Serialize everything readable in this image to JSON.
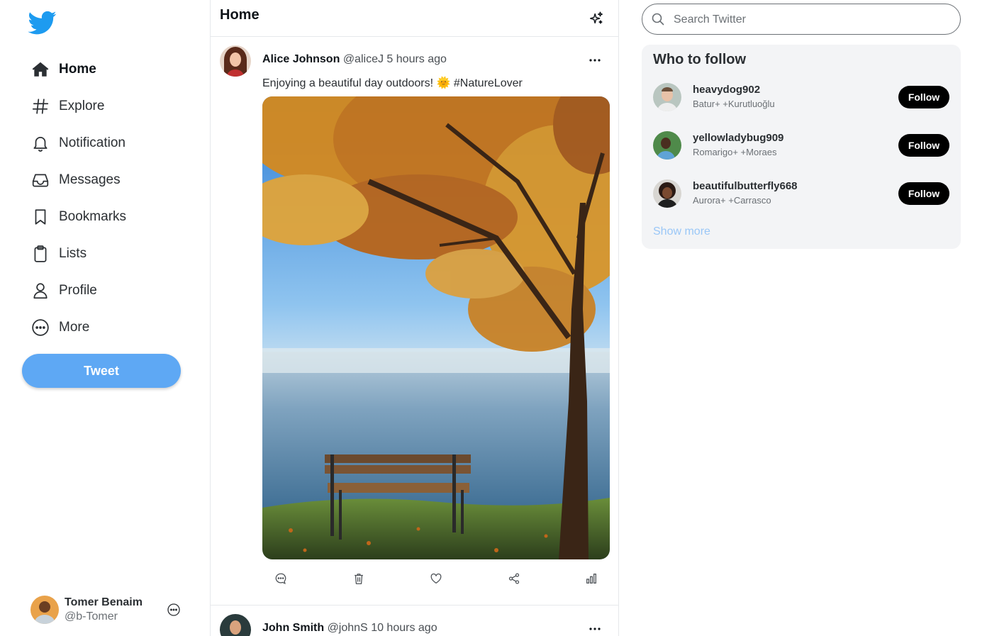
{
  "colors": {
    "brand": "#1d9bf0",
    "tweet_button": "#5ea8f4",
    "show_more": "#9ac7f7",
    "follow_button": "#000000"
  },
  "sidebar": {
    "logo_icon": "twitter-bird-icon",
    "items": [
      {
        "label": "Home",
        "icon": "home-icon",
        "active": true
      },
      {
        "label": "Explore",
        "icon": "hash-icon"
      },
      {
        "label": "Notification",
        "icon": "bell-icon"
      },
      {
        "label": "Messages",
        "icon": "inbox-icon"
      },
      {
        "label": "Bookmarks",
        "icon": "bookmark-icon"
      },
      {
        "label": "Lists",
        "icon": "clipboard-icon"
      },
      {
        "label": "Profile",
        "icon": "user-icon"
      },
      {
        "label": "More",
        "icon": "more-circle-icon"
      }
    ],
    "tweet_button": "Tweet",
    "account": {
      "name": "Tomer Benaim",
      "handle": "@b-Tomer"
    }
  },
  "main": {
    "title": "Home",
    "posts": [
      {
        "name": "Alice Johnson",
        "handle": "@aliceJ",
        "time": "5 hours ago",
        "text": "Enjoying a beautiful day outdoors! 🌞 #NatureLover"
      },
      {
        "name": "John Smith",
        "handle": "@johnS",
        "time": "10 hours ago"
      }
    ]
  },
  "search": {
    "placeholder": "Search Twitter"
  },
  "who_to_follow": {
    "title": "Who to follow",
    "users": [
      {
        "username": "heavydog902",
        "subtitle": "Batur+ +Kurutluoğlu",
        "button": "Follow"
      },
      {
        "username": "yellowladybug909",
        "subtitle": "Romarigo+ +Moraes",
        "button": "Follow"
      },
      {
        "username": "beautifulbutterfly668",
        "subtitle": "Aurora+ +Carrasco",
        "button": "Follow"
      }
    ],
    "show_more": "Show more"
  }
}
